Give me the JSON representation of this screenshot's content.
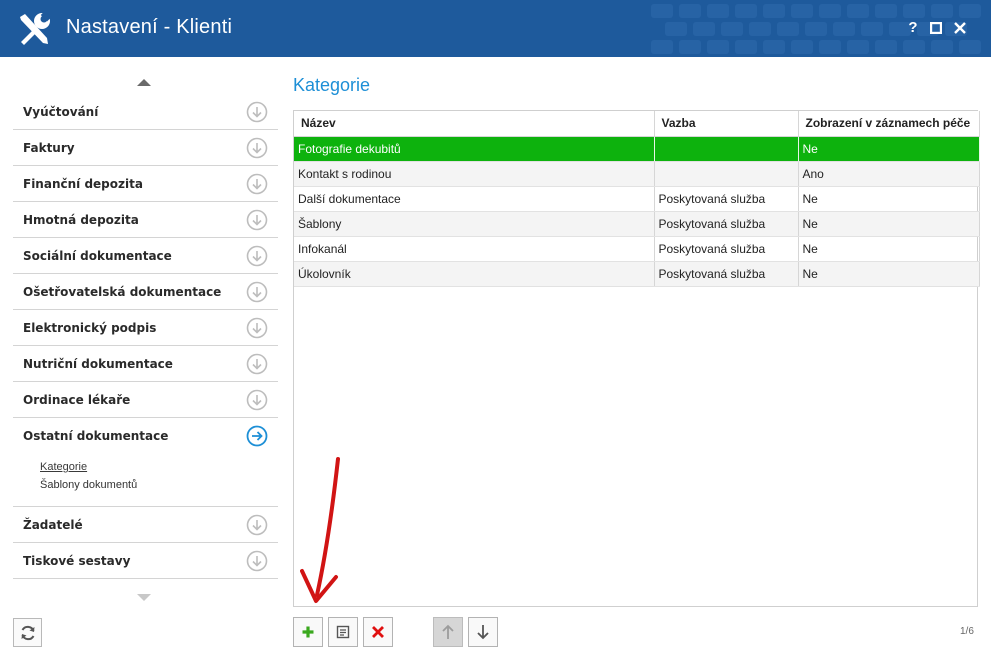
{
  "window": {
    "title": "Nastavení - Klienti",
    "help_label": "?",
    "accent_color": "#1e5a9c"
  },
  "sidebar": {
    "items": [
      {
        "label": "Vyúčtování",
        "icon": "arrow-down-circle-icon"
      },
      {
        "label": "Faktury",
        "icon": "arrow-down-circle-icon"
      },
      {
        "label": "Finanční depozita",
        "icon": "arrow-down-circle-icon"
      },
      {
        "label": "Hmotná depozita",
        "icon": "arrow-down-circle-icon"
      },
      {
        "label": "Sociální dokumentace",
        "icon": "arrow-down-circle-icon"
      },
      {
        "label": "Ošetřovatelská dokumentace",
        "icon": "arrow-down-circle-icon"
      },
      {
        "label": "Elektronický podpis",
        "icon": "arrow-down-circle-icon"
      },
      {
        "label": "Nutriční dokumentace",
        "icon": "arrow-down-circle-icon"
      },
      {
        "label": "Ordinace lékaře",
        "icon": "arrow-down-circle-icon"
      },
      {
        "label": "Ostatní dokumentace",
        "icon": "arrow-right-circle-icon",
        "expanded": true,
        "subitems": [
          {
            "label": "Kategorie",
            "active": true
          },
          {
            "label": "Šablony dokumentů"
          }
        ]
      },
      {
        "label": "Žadatelé",
        "icon": "arrow-down-circle-icon"
      },
      {
        "label": "Tiskové sestavy",
        "icon": "arrow-down-circle-icon"
      }
    ]
  },
  "main": {
    "title": "Kategorie",
    "columns": [
      "Název",
      "Vazba",
      "Zobrazení v záznamech péče"
    ],
    "rows": [
      {
        "nazev": "Fotografie dekubitů",
        "vazba": "",
        "zobrazeni": "Ne",
        "selected": true
      },
      {
        "nazev": "Kontakt s rodinou",
        "vazba": "",
        "zobrazeni": "Ano"
      },
      {
        "nazev": "Další dokumentace",
        "vazba": "Poskytovaná služba",
        "zobrazeni": "Ne"
      },
      {
        "nazev": "Šablony",
        "vazba": "Poskytovaná služba",
        "zobrazeni": "Ne"
      },
      {
        "nazev": "Infokanál",
        "vazba": "Poskytovaná služba",
        "zobrazeni": "Ne"
      },
      {
        "nazev": "Úkolovník",
        "vazba": "Poskytovaná služba",
        "zobrazeni": "Ne"
      }
    ],
    "selected_color": "#0db20d",
    "pager": "1/6"
  },
  "annotation": {
    "color": "#d11414"
  }
}
